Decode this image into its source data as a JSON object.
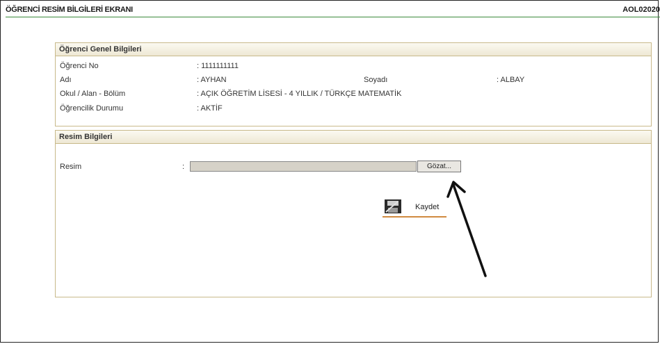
{
  "header": {
    "title": "ÖĞRENCİ RESİM BİLGİLERİ EKRANI",
    "code": "AOL02020"
  },
  "general": {
    "heading": "Öğrenci Genel Bilgileri",
    "student_no_label": "Öğrenci No",
    "student_no_value": ": 1111111111",
    "name_label": "Adı",
    "name_value": ": AYHAN",
    "surname_label": "Soyadı",
    "surname_value": ": ALBAY",
    "school_label": "Okul / Alan - Bölüm",
    "school_value": ": AÇIK ÖĞRETİM LİSESİ - 4 YILLIK / TÜRKÇE MATEMATİK",
    "status_label": "Öğrencilik Durumu",
    "status_value": ": AKTİF"
  },
  "photo": {
    "heading": "Resim Bilgileri",
    "picture_label": "Resim",
    "colon": ":",
    "file_value": "",
    "browse_label": "Gözat...",
    "save_label": "Kaydet"
  },
  "colors": {
    "accent_line": "#3a8a3a",
    "section_border": "#c8b98a",
    "save_underline": "#d08a40"
  }
}
